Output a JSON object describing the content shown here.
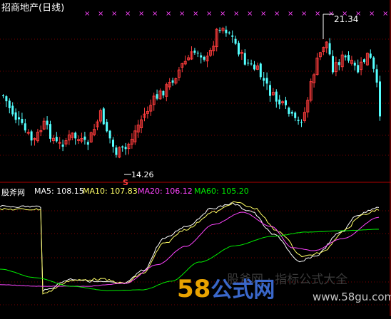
{
  "window": {
    "title": "招商地产(日线)"
  },
  "price_panel": {
    "high_label": "21.34",
    "low_label": "14.26",
    "signal_letter": "S"
  },
  "indicator_panel": {
    "name": "股斧网",
    "ma5": "MA5: 108.15",
    "ma10": "MA10: 107.83",
    "ma20": "MA20: 106.12",
    "ma60": "MA60: 105.20"
  },
  "watermark": {
    "num": "58",
    "text": "公式网",
    "url": "www.58gu.com",
    "faint": "股斧网 · 指标公式大全"
  },
  "colors": {
    "background": "#000000",
    "grid": "#7a0000",
    "up": "#ff3c3c",
    "down": "#54ffff",
    "ma5": "#ffffff",
    "ma10": "#ffff66",
    "ma20": "#ff44ff",
    "ma60": "#00ee00",
    "marker": "#ff44ff",
    "panel_divider": "#b00000"
  }
}
